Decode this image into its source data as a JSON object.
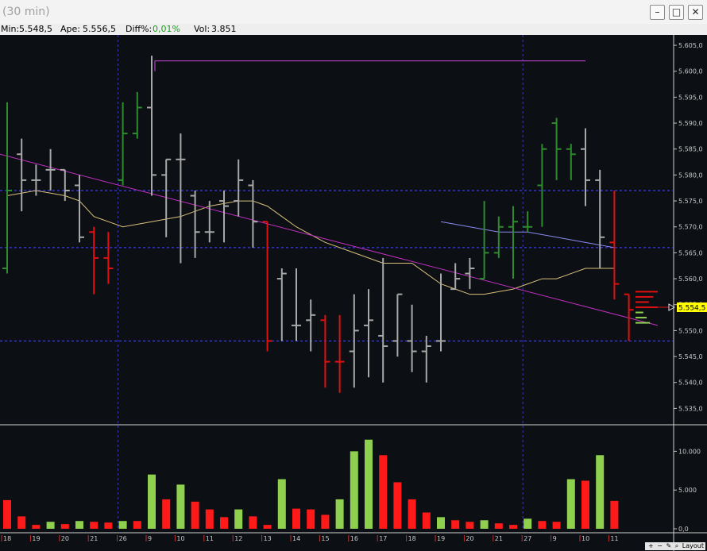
{
  "window": {
    "title": "(30 min)",
    "minimize_glyph": "–",
    "maximize_glyph": "□",
    "close_glyph": "✕"
  },
  "info": {
    "min_label": "Min:",
    "min_value": "5.548,5",
    "open_label": "Ape:",
    "open_value": "5.556,5",
    "diff_label": "Diff%:",
    "diff_value": "0,01%",
    "vol_label": "Vol:",
    "vol_value": "3.851",
    "diff_color": "#1a9e1a"
  },
  "toolbar": {
    "zoom_in": "+",
    "zoom_out": "−",
    "draw": "✎",
    "search": "⌕",
    "layout_label": "Layout"
  },
  "colors": {
    "up_bar": "#2e8b2e",
    "down_bar": "#e01010",
    "neutral_bar": "#a8a8a8",
    "vol_up": "#8fd14f",
    "vol_down": "#ff1a1a",
    "ma_slow": "#d9c07a",
    "ma_fast": "#8a8af0",
    "trendline": "#c030c0",
    "resistance": "#b040c0",
    "grid_blue": "#4a4aff",
    "last_price_bg": "#ffff00"
  },
  "chart_data": {
    "type": "ohlc",
    "timeframe": "30 min",
    "price_axis": {
      "range": [
        5532,
        5607
      ],
      "tick_labels": [
        "5.605,0",
        "5.600,0",
        "5.595,0",
        "5.590,0",
        "5.585,0",
        "5.580,0",
        "5.575,0",
        "5.570,0",
        "5.565,0",
        "5.560,0",
        "5.555,0",
        "5.550,0",
        "5.545,0",
        "5.540,0",
        "5.535,0"
      ],
      "tick_values": [
        5605,
        5600,
        5595,
        5590,
        5585,
        5580,
        5575,
        5570,
        5565,
        5560,
        5555,
        5550,
        5545,
        5540,
        5535
      ],
      "last_price_label": "5.554,5",
      "last_price": 5554.5
    },
    "volume_axis": {
      "range": [
        0,
        12500
      ],
      "tick_labels": [
        "10.000",
        "5.000",
        "0,0"
      ],
      "tick_values": [
        10000,
        5000,
        0
      ]
    },
    "x_tick_labels": [
      "18",
      "19",
      "20",
      "21",
      "26",
      "9",
      "10",
      "11",
      "12",
      "13",
      "14",
      "15",
      "16",
      "17",
      "18",
      "19",
      "20",
      "21",
      "27",
      "9",
      "10",
      "11"
    ],
    "x_tick_positions": [
      0,
      2,
      4,
      6,
      8,
      10,
      12,
      14,
      16,
      18,
      20,
      22,
      24,
      26,
      28,
      30,
      32,
      34,
      36,
      38,
      40,
      42
    ],
    "bars": [
      {
        "o": 5562,
        "h": 5594,
        "l": 5561,
        "c": 5577,
        "d": "up"
      },
      {
        "o": 5584,
        "h": 5587,
        "l": 5573,
        "c": 5579,
        "d": "flat"
      },
      {
        "o": 5579,
        "h": 5582,
        "l": 5576,
        "c": 5579,
        "d": "flat"
      },
      {
        "o": 5581,
        "h": 5585,
        "l": 5577,
        "c": 5581,
        "d": "flat"
      },
      {
        "o": 5581,
        "h": 5581,
        "l": 5575,
        "c": 5577,
        "d": "flat"
      },
      {
        "o": 5578,
        "h": 5580,
        "l": 5567,
        "c": 5568,
        "d": "flat"
      },
      {
        "o": 5569,
        "h": 5570,
        "l": 5557,
        "c": 5564,
        "d": "down"
      },
      {
        "o": 5564,
        "h": 5569,
        "l": 5559,
        "c": 5562,
        "d": "down"
      },
      {
        "o": 5579,
        "h": 5594,
        "l": 5578,
        "c": 5588,
        "d": "up"
      },
      {
        "o": 5588,
        "h": 5596,
        "l": 5587,
        "c": 5593,
        "d": "up"
      },
      {
        "o": 5593,
        "h": 5603,
        "l": 5576,
        "c": 5580,
        "d": "flat"
      },
      {
        "o": 5580,
        "h": 5583,
        "l": 5568,
        "c": 5583,
        "d": "flat"
      },
      {
        "o": 5583,
        "h": 5588,
        "l": 5563,
        "c": 5583,
        "d": "flat"
      },
      {
        "o": 5576,
        "h": 5577,
        "l": 5564,
        "c": 5569,
        "d": "flat"
      },
      {
        "o": 5569,
        "h": 5575,
        "l": 5567,
        "c": 5569,
        "d": "flat"
      },
      {
        "o": 5575,
        "h": 5577,
        "l": 5567,
        "c": 5574,
        "d": "flat"
      },
      {
        "o": 5575,
        "h": 5583,
        "l": 5572,
        "c": 5579,
        "d": "flat"
      },
      {
        "o": 5578,
        "h": 5579,
        "l": 5566,
        "c": 5571,
        "d": "flat"
      },
      {
        "o": 5571,
        "h": 5571,
        "l": 5546,
        "c": 5548,
        "d": "down"
      },
      {
        "o": 5560,
        "h": 5562,
        "l": 5548,
        "c": 5561,
        "d": "flat"
      },
      {
        "o": 5551,
        "h": 5562,
        "l": 5548,
        "c": 5551,
        "d": "flat"
      },
      {
        "o": 5552,
        "h": 5556,
        "l": 5546,
        "c": 5553,
        "d": "flat"
      },
      {
        "o": 5552,
        "h": 5553,
        "l": 5539,
        "c": 5544,
        "d": "down"
      },
      {
        "o": 5544,
        "h": 5553,
        "l": 5538,
        "c": 5544,
        "d": "down"
      },
      {
        "o": 5546,
        "h": 5557,
        "l": 5539,
        "c": 5550,
        "d": "flat"
      },
      {
        "o": 5551,
        "h": 5558,
        "l": 5541,
        "c": 5552,
        "d": "flat"
      },
      {
        "o": 5549,
        "h": 5564,
        "l": 5540,
        "c": 5547,
        "d": "flat"
      },
      {
        "o": 5548,
        "h": 5557,
        "l": 5545,
        "c": 5557,
        "d": "flat"
      },
      {
        "o": 5548,
        "h": 5555,
        "l": 5542,
        "c": 5546,
        "d": "flat"
      },
      {
        "o": 5546,
        "h": 5549,
        "l": 5540,
        "c": 5547,
        "d": "flat"
      },
      {
        "o": 5548,
        "h": 5561,
        "l": 5546,
        "c": 5548,
        "d": "flat"
      },
      {
        "o": 5558,
        "h": 5563,
        "l": 5558,
        "c": 5560,
        "d": "flat"
      },
      {
        "o": 5561,
        "h": 5564,
        "l": 5558,
        "c": 5562,
        "d": "flat"
      },
      {
        "o": 5560,
        "h": 5575,
        "l": 5560,
        "c": 5565,
        "d": "up"
      },
      {
        "o": 5565,
        "h": 5572,
        "l": 5564,
        "c": 5570,
        "d": "up"
      },
      {
        "o": 5570,
        "h": 5574,
        "l": 5560,
        "c": 5571,
        "d": "up"
      },
      {
        "o": 5570,
        "h": 5573,
        "l": 5569,
        "c": 5570,
        "d": "up"
      },
      {
        "o": 5578,
        "h": 5586,
        "l": 5570,
        "c": 5585,
        "d": "up"
      },
      {
        "o": 5590,
        "h": 5591,
        "l": 5579,
        "c": 5585,
        "d": "up"
      },
      {
        "o": 5585,
        "h": 5586,
        "l": 5579,
        "c": 5584,
        "d": "up"
      },
      {
        "o": 5585,
        "h": 5589,
        "l": 5574,
        "c": 5579,
        "d": "flat"
      },
      {
        "o": 5579,
        "h": 5581,
        "l": 5562,
        "c": 5568,
        "d": "flat"
      },
      {
        "o": 5567,
        "h": 5577,
        "l": 5556,
        "c": 5559,
        "d": "down"
      },
      {
        "o": 5557,
        "h": 5557,
        "l": 5548,
        "c": 5554,
        "d": "down"
      }
    ],
    "volume": [
      {
        "v": 3700,
        "d": "down"
      },
      {
        "v": 1600,
        "d": "down"
      },
      {
        "v": 500,
        "d": "down"
      },
      {
        "v": 900,
        "d": "up"
      },
      {
        "v": 600,
        "d": "down"
      },
      {
        "v": 1000,
        "d": "up"
      },
      {
        "v": 900,
        "d": "down"
      },
      {
        "v": 800,
        "d": "down"
      },
      {
        "v": 1000,
        "d": "up"
      },
      {
        "v": 1000,
        "d": "down"
      },
      {
        "v": 7000,
        "d": "up"
      },
      {
        "v": 3800,
        "d": "down"
      },
      {
        "v": 5700,
        "d": "up"
      },
      {
        "v": 3500,
        "d": "down"
      },
      {
        "v": 2500,
        "d": "down"
      },
      {
        "v": 1500,
        "d": "down"
      },
      {
        "v": 2500,
        "d": "up"
      },
      {
        "v": 1600,
        "d": "down"
      },
      {
        "v": 500,
        "d": "down"
      },
      {
        "v": 6400,
        "d": "up"
      },
      {
        "v": 2600,
        "d": "down"
      },
      {
        "v": 2500,
        "d": "down"
      },
      {
        "v": 1800,
        "d": "down"
      },
      {
        "v": 3800,
        "d": "up"
      },
      {
        "v": 10000,
        "d": "up"
      },
      {
        "v": 11500,
        "d": "up"
      },
      {
        "v": 9500,
        "d": "down"
      },
      {
        "v": 6000,
        "d": "down"
      },
      {
        "v": 3800,
        "d": "down"
      },
      {
        "v": 2100,
        "d": "down"
      },
      {
        "v": 1500,
        "d": "up"
      },
      {
        "v": 1100,
        "d": "down"
      },
      {
        "v": 900,
        "d": "down"
      },
      {
        "v": 1100,
        "d": "up"
      },
      {
        "v": 700,
        "d": "down"
      },
      {
        "v": 500,
        "d": "down"
      },
      {
        "v": 1300,
        "d": "up"
      },
      {
        "v": 1000,
        "d": "down"
      },
      {
        "v": 900,
        "d": "down"
      },
      {
        "v": 6400,
        "d": "up"
      },
      {
        "v": 6200,
        "d": "down"
      },
      {
        "v": 9500,
        "d": "up"
      },
      {
        "v": 3600,
        "d": "down"
      }
    ],
    "ma_slow": [
      [
        0,
        5576
      ],
      [
        2,
        5577
      ],
      [
        4,
        5576
      ],
      [
        5,
        5575
      ],
      [
        6,
        5572
      ],
      [
        7,
        5571
      ],
      [
        8,
        5570
      ],
      [
        10,
        5571
      ],
      [
        12,
        5572
      ],
      [
        14,
        5574
      ],
      [
        16,
        5575
      ],
      [
        17,
        5575
      ],
      [
        18,
        5574
      ],
      [
        19,
        5572
      ],
      [
        20,
        5570
      ],
      [
        22,
        5567
      ],
      [
        24,
        5565
      ],
      [
        26,
        5563
      ],
      [
        28,
        5563
      ],
      [
        29,
        5561
      ],
      [
        30,
        5559
      ],
      [
        31,
        5558
      ],
      [
        32,
        5557
      ],
      [
        33,
        5557
      ],
      [
        35,
        5558
      ],
      [
        36,
        5559
      ],
      [
        37,
        5560
      ],
      [
        38,
        5560
      ],
      [
        39,
        5561
      ],
      [
        40,
        5562
      ],
      [
        41,
        5562
      ],
      [
        42,
        5562
      ]
    ],
    "ma_fast": [
      [
        30,
        5571
      ],
      [
        32,
        5570
      ],
      [
        34,
        5569
      ],
      [
        36,
        5569
      ],
      [
        38,
        5568
      ],
      [
        40,
        5567
      ],
      [
        42,
        5566
      ]
    ],
    "trendline": {
      "from": [
        0,
        5584
      ],
      "to": [
        45,
        5551
      ]
    },
    "resistance": {
      "from": [
        10,
        5602
      ],
      "to": [
        40,
        5602
      ],
      "price": 5602
    },
    "support_lines": [
      5577,
      5566,
      5548
    ],
    "session_markers": [
      8,
      36
    ],
    "depth_orders": {
      "ask": [
        {
          "p": 5557.5,
          "q": 1.0
        },
        {
          "p": 5556.5,
          "q": 0.8
        },
        {
          "p": 5555.5,
          "q": 0.6
        },
        {
          "p": 5554.5,
          "q": 1.0
        }
      ],
      "bid": [
        {
          "p": 5553.5,
          "q": 0.35
        },
        {
          "p": 5552.5,
          "q": 0.5
        },
        {
          "p": 5551.5,
          "q": 0.65
        }
      ]
    }
  }
}
